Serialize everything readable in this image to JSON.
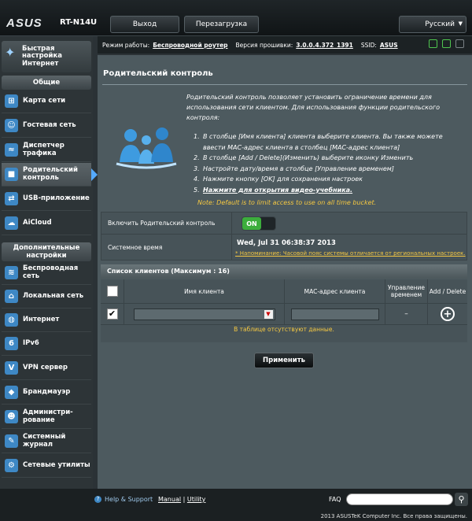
{
  "header": {
    "brand": "ASUS",
    "model": "RT-N14U",
    "logout_label": "Выход",
    "reboot_label": "Перезагрузка",
    "language": "Русский"
  },
  "status": {
    "mode_label": "Режим работы:",
    "mode_value": "Беспроводной роутер",
    "fw_label": "Версия прошивки:",
    "fw_value": "3.0.0.4.372_1391",
    "ssid_label": "SSID:",
    "ssid_value": "ASUS"
  },
  "sidebar": {
    "qis": "Быстрая настройка Интернет",
    "general_header": "Общие",
    "general_items": [
      {
        "label": "Карта сети",
        "icon": "network-map-icon"
      },
      {
        "label": "Гостевая сеть",
        "icon": "guest-network-icon"
      },
      {
        "label": "Диспетчер трафика",
        "icon": "traffic-manager-icon"
      },
      {
        "label": "Родительский контроль",
        "icon": "lock-icon"
      },
      {
        "label": "USB-приложение",
        "icon": "usb-icon"
      },
      {
        "label": "AiCloud",
        "icon": "cloud-icon"
      }
    ],
    "advanced_header": "Дополнительные настройки",
    "advanced_items": [
      {
        "label": "Беспроводная сеть",
        "icon": "wireless-icon"
      },
      {
        "label": "Локальная сеть",
        "icon": "home-icon"
      },
      {
        "label": "Интернет",
        "icon": "globe-icon"
      },
      {
        "label": "IPv6",
        "icon": "ipv6-icon"
      },
      {
        "label": "VPN сервер",
        "icon": "vpn-icon"
      },
      {
        "label": "Брандмауэр",
        "icon": "shield-icon"
      },
      {
        "label": "Администри-рование",
        "icon": "admin-icon"
      },
      {
        "label": "Системный журнал",
        "icon": "log-icon"
      },
      {
        "label": "Сетевые утилиты",
        "icon": "tools-icon"
      }
    ]
  },
  "main": {
    "title": "Родительский контроль",
    "description": "Родительский контроль позволяет установить ограничение времени для использования сети клиентом. Для использования функции родительского контроля:",
    "steps": [
      "В столбце [Имя клиента] клиента выберите клиента. Вы также можете ввести MAC-адрес клиента в столбец [MAC-адрес клиента]",
      "В столбце [Add / Delete](Изменить) выберите иконку Изменить",
      "Настройте дату/время в столбце [Управление временем]",
      "Нажмите кнопку [OK] для сохранения настроек",
      "Нажмите для открытия видео-учебника."
    ],
    "note": "Note: Default is to limit access to use on all time bucket.",
    "enable_label": "Включить Родительский контроль",
    "toggle_state": "ON",
    "system_time_label": "Системное время",
    "system_time": "Wed, Jul 31 06:38:37 2013",
    "tz_note": "* Напоминание: Часовой пояс системы отличается от региональных настроек.",
    "client_list_title": "Список клиентов (Максимум : 16)",
    "columns": [
      "Имя клиента",
      "MAC-адрес клиента",
      "Управление временем",
      "Add / Delete"
    ],
    "time_cell": "–",
    "empty_msg": "В таблице отсутствуют данные.",
    "apply_label": "Применить"
  },
  "footer": {
    "help": "Help & Support",
    "manual": "Manual",
    "separator": "|",
    "utility": "Utility",
    "faq": "FAQ",
    "copyright": "2013 ASUSTeK Computer Inc. Все права защищены."
  }
}
